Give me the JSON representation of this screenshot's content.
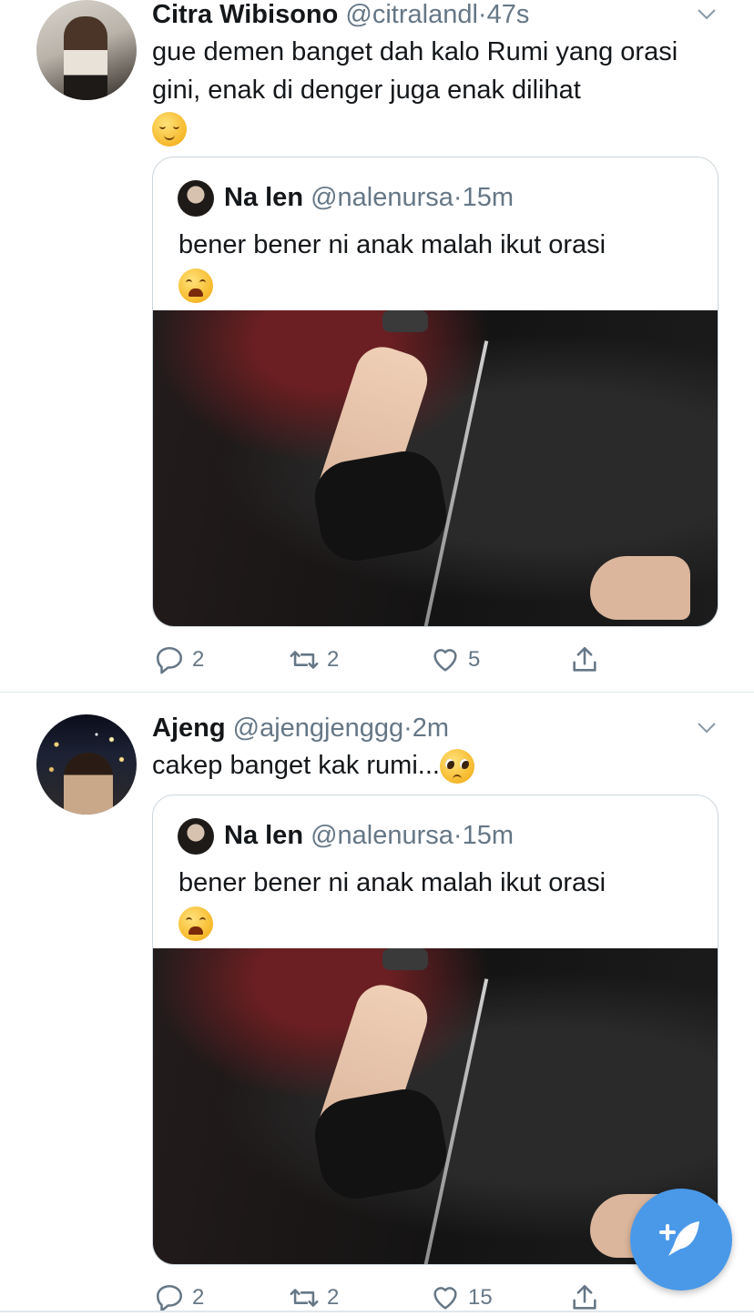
{
  "tweets": [
    {
      "name": "Citra Wibisono",
      "handle": "@citralandl",
      "time": "47s",
      "text": "gue demen banget dah kalo Rumi yang orasi gini, enak di denger juga enak dilihat",
      "emoji": "relieved-face",
      "quote": {
        "name": "Na len",
        "handle": "@nalenursa",
        "time": "15m",
        "text": "bener bener ni anak malah ikut orasi",
        "emoji": "weary-face"
      },
      "replies": "2",
      "retweets": "2",
      "likes": "5"
    },
    {
      "name": "Ajeng",
      "handle": "@ajengjenggg",
      "time": "2m",
      "text": "cakep banget kak rumi...",
      "emoji": "pleading-face",
      "quote": {
        "name": "Na len",
        "handle": "@nalenursa",
        "time": "15m",
        "text": "bener bener ni anak malah ikut orasi",
        "emoji": "weary-face"
      },
      "replies": "2",
      "retweets": "2",
      "likes": "15"
    }
  ],
  "separator": "·",
  "colors": {
    "accent": "#4a99e9",
    "muted": "#657786",
    "border": "#ccd6dd"
  }
}
